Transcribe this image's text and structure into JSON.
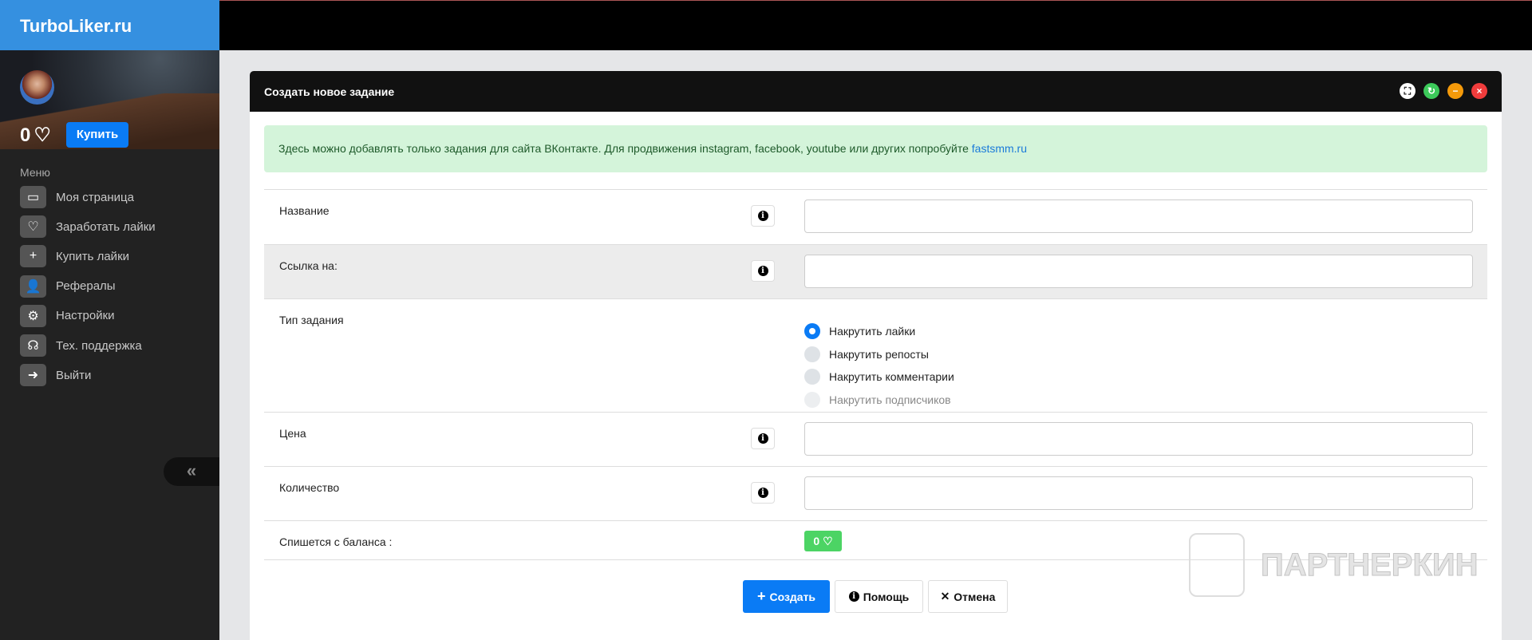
{
  "brand": "TurboLiker.ru",
  "profile": {
    "balance": "0",
    "buy_label": "Купить"
  },
  "menu": {
    "label": "Меню",
    "items": [
      {
        "icon": "monitor-icon",
        "glyph": "▭",
        "label": "Моя страница"
      },
      {
        "icon": "heart-icon",
        "glyph": "♡",
        "label": "Заработать лайки"
      },
      {
        "icon": "plus-icon",
        "glyph": "+",
        "label": "Купить лайки"
      },
      {
        "icon": "user-plus-icon",
        "glyph": "👤",
        "label": "Рефералы"
      },
      {
        "icon": "gears-icon",
        "glyph": "⚙",
        "label": "Настройки"
      },
      {
        "icon": "headset-icon",
        "glyph": "☊",
        "label": "Тех. поддержка"
      },
      {
        "icon": "sign-out-icon",
        "glyph": "➜",
        "label": "Выйти"
      }
    ]
  },
  "collapse_glyph": "«",
  "panel": {
    "title": "Создать новое задание",
    "alert_text": "Здесь можно добавлять только задания для сайта ВКонтакте. Для продвижения instagram, facebook, youtube или других попробуйте ",
    "alert_link": "fastsmm.ru",
    "fields": {
      "name": "Название",
      "link": "Ссылка на:",
      "type": "Тип задания",
      "price": "Цена",
      "quantity": "Количество",
      "charge": "Спишется с баланса :"
    },
    "task_types": [
      {
        "label": "Накрутить лайки",
        "selected": true,
        "disabled": false
      },
      {
        "label": "Накрутить репосты",
        "selected": false,
        "disabled": false
      },
      {
        "label": "Накрутить комментарии",
        "selected": false,
        "disabled": false
      },
      {
        "label": "Накрутить подписчиков",
        "selected": false,
        "disabled": true
      }
    ],
    "charge_value": "0",
    "buttons": {
      "create": "Создать",
      "help": "Помощь",
      "cancel": "Отмена"
    }
  },
  "watermark": "ПАРТНЕРКИН",
  "colors": {
    "brand": "#3590e0",
    "primary": "#0a7bf5",
    "success": "#4cd464",
    "alert_bg": "#d4f4da"
  }
}
